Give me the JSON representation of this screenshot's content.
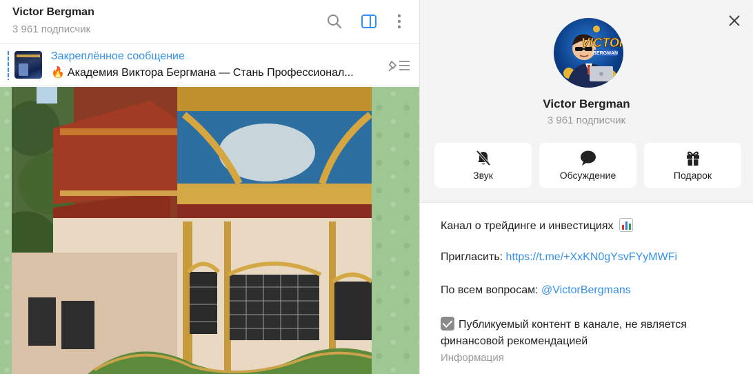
{
  "header": {
    "title": "Victor Bergman",
    "subscribers": "3 961 подписчик",
    "icons": [
      "search-icon",
      "sidebar-toggle-icon",
      "more-vertical-icon"
    ]
  },
  "pinned": {
    "title": "Закреплённое сообщение",
    "text": "Академия Виктора Бергмана — Стань Профессионал...",
    "emoji": "🔥"
  },
  "profile": {
    "name": "Victor Bergman",
    "subscribers": "3 961 подписчик",
    "avatar_text": "VICTOR",
    "avatar_subtext": "BERGMAN"
  },
  "actions": [
    {
      "label": "Звук",
      "icon": "bell-muted-icon"
    },
    {
      "label": "Обсуждение",
      "icon": "chat-bubble-icon"
    },
    {
      "label": "Подарок",
      "icon": "gift-icon"
    }
  ],
  "info": {
    "description": "Канал о трейдинге и инвестициях",
    "invite_label": "Пригласить: ",
    "invite_link": "https://t.me/+XxKN0gYsvFYyMWFi",
    "questions_label": "По всем вопросам: ",
    "questions_link": "@VictorBergmans",
    "disclaimer": "Публикуемый контент в канале, не является финансовой рекомендацией",
    "section_label": "Информация"
  },
  "colors": {
    "accent": "#3390ec",
    "muted": "#999999",
    "panel_bg": "#f4f4f5",
    "chat_bg": "#9fc793"
  }
}
